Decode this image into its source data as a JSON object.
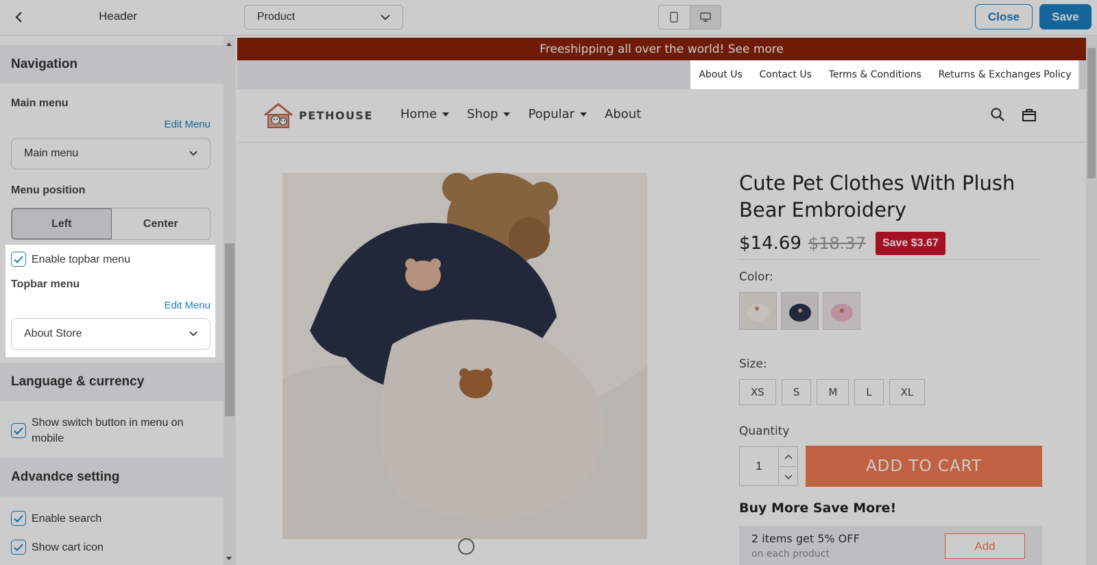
{
  "topbar": {
    "panel_title": "Header",
    "page_select": "Product",
    "close_label": "Close",
    "save_label": "Save"
  },
  "sidebar": {
    "navigation": {
      "heading": "Navigation",
      "main_menu_label": "Main menu",
      "edit_menu": "Edit Menu",
      "main_menu_value": "Main menu",
      "menu_position_label": "Menu position",
      "position_options": [
        "Left",
        "Center"
      ],
      "position_selected": "Left",
      "enable_topbar_label": "Enable topbar menu",
      "enable_topbar_checked": true,
      "topbar_menu_label": "Topbar menu",
      "topbar_edit_menu": "Edit Menu",
      "topbar_menu_value": "About Store"
    },
    "language": {
      "heading": "Language & currency",
      "switch_label": "Show switch button in menu on mobile",
      "switch_checked": true
    },
    "advanced": {
      "heading": "Advandce setting",
      "search_label": "Enable search",
      "search_checked": true,
      "cart_label": "Show cart icon",
      "cart_checked": true
    }
  },
  "preview": {
    "announcement": "Freeshipping all over the world! See more",
    "top_links": [
      "About Us",
      "Contact Us",
      "Terms & Conditions",
      "Returns & Exchanges Policy"
    ],
    "logo_text": "PETHOUSE",
    "nav": [
      "Home",
      "Shop",
      "Popular",
      "About"
    ],
    "product": {
      "title": "Cute Pet Clothes With Plush Bear Embroidery",
      "price": "$14.69",
      "compare_price": "$18.37",
      "save_badge": "Save $3.67",
      "color_label": "Color:",
      "size_label": "Size:",
      "sizes": [
        "XS",
        "S",
        "M",
        "L",
        "XL"
      ],
      "quantity_label": "Quantity",
      "quantity_value": "1",
      "add_to_cart": "ADD TO CART",
      "bundle_heading": "Buy More Save More!",
      "offer_main": "2 items get 5% OFF",
      "offer_sub": "on each product",
      "offer_add": "Add"
    }
  },
  "colors": {
    "accent": "#1a7fc1",
    "announcement_bg": "#8b2209",
    "add_to_cart_bg": "#f07a52",
    "save_badge_bg": "#d0142c"
  }
}
